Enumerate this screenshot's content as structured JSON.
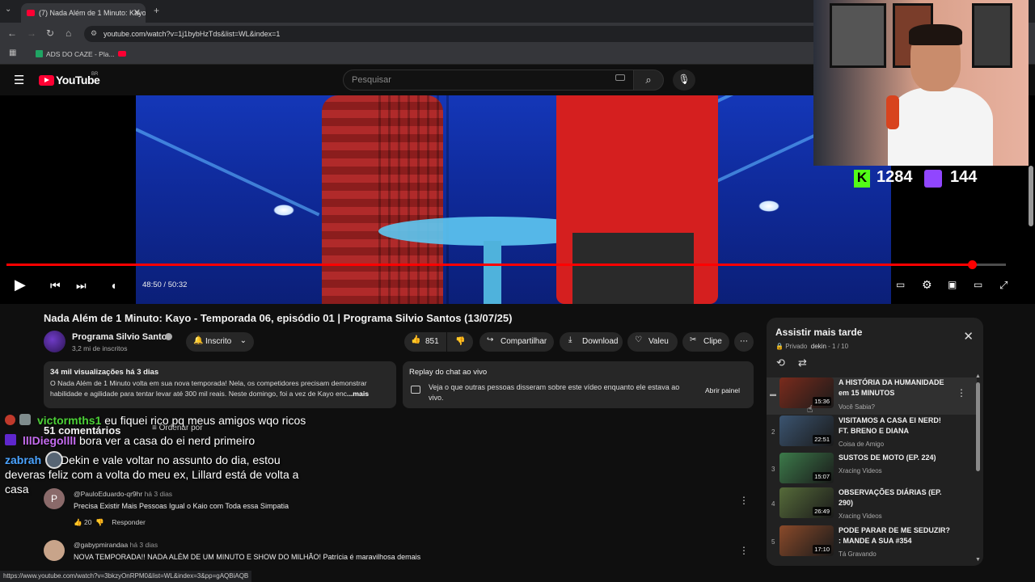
{
  "browser": {
    "tab_title": "(7) Nada Além de 1 Minuto: Kayo",
    "url": "youtube.com/watch?v=1j1bybHzTds&list=WL&index=1",
    "bookmark": "ADS DO CAZE - Pla...",
    "status_url": "https://www.youtube.com/watch?v=3bkzyOnRPM0&list=WL&index=3&pp=gAQBiAQB"
  },
  "header": {
    "logo": "YouTube",
    "region": "BR",
    "search_placeholder": "Pesquisar"
  },
  "player": {
    "time": "48:50 / 50:32",
    "progress_fraction": 0.966
  },
  "stream": {
    "kick_count": "1284",
    "twitch_count": "144"
  },
  "video": {
    "title": "Nada Além de 1 Minuto: Kayo - Temporada 06, episódio 01 | Programa Silvio Santos (13/07/25)",
    "channel": "Programa Silvio Santos",
    "subscribers": "3,2 mi de inscritos",
    "subscribe_label": "Inscrito",
    "likes": "851",
    "share_label": "Compartilhar",
    "download_label": "Download",
    "thanks_label": "Valeu",
    "clip_label": "Clipe"
  },
  "description": {
    "meta": "34 mil visualizações  há 3 dias",
    "text": "O Nada Além de 1 Minuto volta em sua nova temporada! Nela, os competidores precisam demonstrar habilidade e agilidade para tentar levar até 300 mil reais. Neste domingo, foi a vez de Kayo enc",
    "more": "...mais"
  },
  "replay": {
    "heading": "Replay do chat ao vivo",
    "text": "Veja o que outras pessoas disseram sobre este vídeo enquanto ele estava ao vivo.",
    "button": "Abrir painel"
  },
  "chat": [
    {
      "user": "victormths1",
      "msg": " eu fiquei rico pq meus amigos wqo ricos",
      "color": "#4cd137"
    },
    {
      "user": "lllDiegolllI",
      "msg": " bora ver a casa do ei nerd primeiro",
      "color": "#c56cf0"
    },
    {
      "user": "zabrah",
      "msg": " Dekin e vale voltar no assunto do dia, estou",
      "color": "#4aa3ff"
    },
    {
      "user": "",
      "msg": "deveras feliz com a volta do meu ex, Lillard está de volta a",
      "color": "#ffffff"
    },
    {
      "user": "",
      "msg": "casa",
      "color": "#ffffff"
    }
  ],
  "comments": {
    "count": "51 comentários",
    "sort": "Ordenar por",
    "items": [
      {
        "initial": "P",
        "author": "@PauloEduardo-qr9hr",
        "when": "há 3 dias",
        "text": "Precisa Existir Mais Pessoas Igual o Kaio com Toda essa Simpatia",
        "likes": "20",
        "reply": "Responder"
      },
      {
        "initial": "",
        "author": "@gabypmirandaa",
        "when": "há 3 dias",
        "text": "NOVA TEMPORADA!! NADA ALÉM DE UM MINUTO E SHOW DO MILHÃO! Patrícia é maravilhosa demais",
        "likes": "",
        "reply": ""
      }
    ]
  },
  "playlist": {
    "title": "Assistir mais tarde",
    "privacy": "Privado",
    "owner": "dekin",
    "position": "1 / 10",
    "items": [
      {
        "index": "",
        "title": "A HISTÓRIA DA HUMANIDADE em 15 MINUTOS",
        "channel": "Você Sabia?",
        "duration": "15:36",
        "thumb": "#7a2b1c"
      },
      {
        "index": "2",
        "title": "VISITAMOS A CASA EI NERD! FT. BRENO E DIANA",
        "channel": "Coisa de Amigo",
        "duration": "22:51",
        "thumb": "#3b5470"
      },
      {
        "index": "3",
        "title": "SUSTOS DE MOTO (EP. 224)",
        "channel": "Xracing Videos",
        "duration": "15:07",
        "thumb": "#3c7a4a"
      },
      {
        "index": "4",
        "title": "OBSERVAÇÕES DIÁRIAS (EP. 290)",
        "channel": "Xracing Videos",
        "duration": "26:49",
        "thumb": "#566b3a"
      },
      {
        "index": "5",
        "title": "PODE PARAR DE ME SEDUZIR? : MANDE A SUA #354",
        "channel": "Tá Gravando",
        "duration": "17:10",
        "thumb": "#8a4a2a"
      }
    ]
  }
}
